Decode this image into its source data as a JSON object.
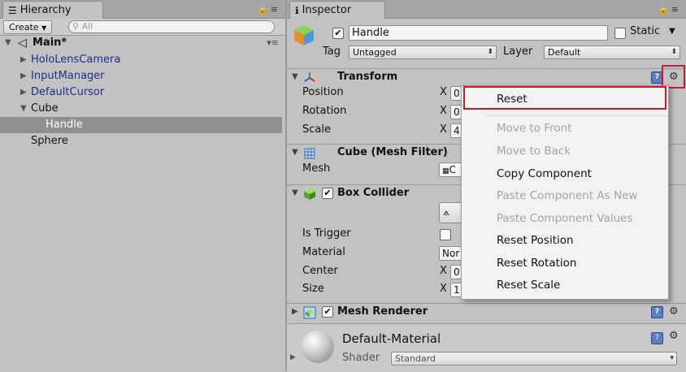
{
  "hierarchy": {
    "tab_title": "Hierarchy",
    "create_label": "Create",
    "search_placeholder": "All",
    "scene_name": "Main*",
    "items": [
      {
        "label": "HoloLensCamera"
      },
      {
        "label": "InputManager"
      },
      {
        "label": "DefaultCursor"
      },
      {
        "label": "Cube"
      },
      {
        "label": "Handle"
      },
      {
        "label": "Sphere"
      }
    ]
  },
  "inspector": {
    "tab_title": "Inspector",
    "object_name": "Handle",
    "static_label": "Static",
    "tag_label": "Tag",
    "tag_value": "Untagged",
    "layer_label": "Layer",
    "layer_value": "Default",
    "transform": {
      "title": "Transform",
      "position_label": "Position",
      "rotation_label": "Rotation",
      "scale_label": "Scale",
      "axis_x": "X",
      "position_x": "0",
      "rotation_x": "0",
      "scale_x": "4"
    },
    "mesh_filter": {
      "title": "Cube (Mesh Filter)",
      "mesh_label": "Mesh",
      "mesh_value": "C"
    },
    "box_collider": {
      "title": "Box Collider",
      "is_trigger_label": "Is Trigger",
      "material_label": "Material",
      "material_value": "Nor",
      "center_label": "Center",
      "center_x": "0",
      "size_label": "Size",
      "size_x": "1",
      "axis_x": "X"
    },
    "mesh_renderer": {
      "title": "Mesh Renderer"
    },
    "material": {
      "name": "Default-Material",
      "shader_label": "Shader",
      "shader_value": "Standard"
    }
  },
  "context_menu": {
    "items": [
      {
        "label": "Reset",
        "enabled": true
      },
      {
        "label": "Move to Front",
        "enabled": false
      },
      {
        "label": "Move to Back",
        "enabled": false
      },
      {
        "label": "Copy Component",
        "enabled": true
      },
      {
        "label": "Paste Component As New",
        "enabled": false
      },
      {
        "label": "Paste Component Values",
        "enabled": false
      },
      {
        "label": "Reset Position",
        "enabled": true
      },
      {
        "label": "Reset Rotation",
        "enabled": true
      },
      {
        "label": "Reset Scale",
        "enabled": true
      }
    ]
  },
  "icons": [
    "hierarchy-icon",
    "lock-icon",
    "menu-icon",
    "search-icon",
    "unity-scene-icon",
    "info-icon",
    "cube-icon",
    "transform-icon",
    "mesh-filter-icon",
    "box-collider-icon",
    "mesh-renderer-icon",
    "help-icon",
    "gear-icon",
    "material-sphere-icon"
  ],
  "colors": {
    "highlight_box": "#d0182a",
    "panel_bg": "#c2c2c2",
    "selection_bg": "#8f8f8f",
    "prefab_blue": "#1c2f8c"
  }
}
